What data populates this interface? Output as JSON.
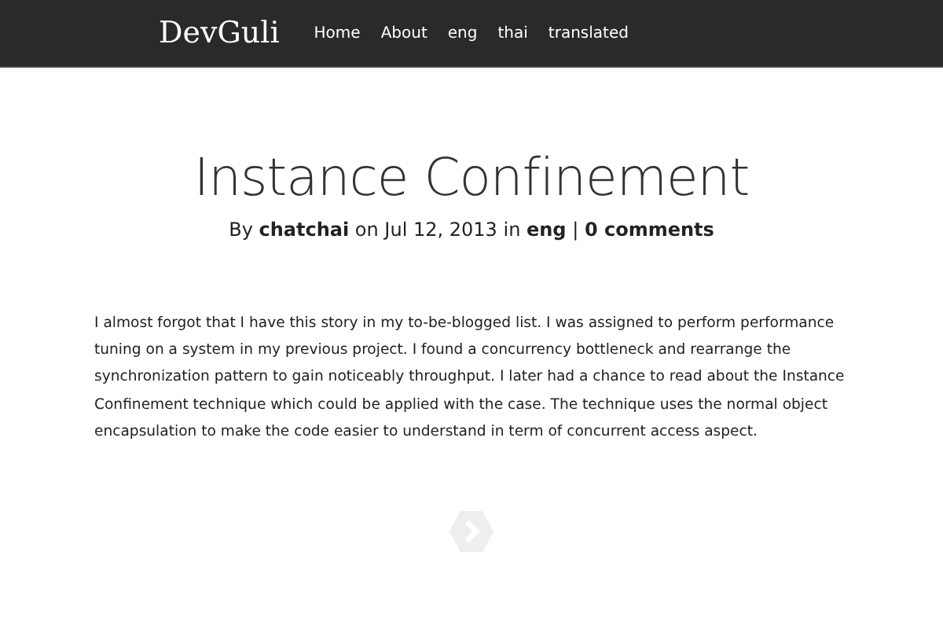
{
  "navbar": {
    "brand": "DevGuli",
    "links": [
      "Home",
      "About",
      "eng",
      "thai",
      "translated"
    ]
  },
  "post": {
    "title": "Instance Confinement",
    "meta": "By **chatchai** on Jul 12, 2013 in **eng** | **0 comments**",
    "body": "I almost forgot that I have this story in my to-be-blogged list. I was assigned to perform performance tuning on a system in my previous project. I found a concurrency bottleneck and rearrange the synchronization pattern to gain noticeably throughput. I later had a chance to read about the Instance Confinement technique which could be applied with the case. The technique uses the normal object encapsulation to make the code easier to understand in term of concurrent access aspect."
  }
}
